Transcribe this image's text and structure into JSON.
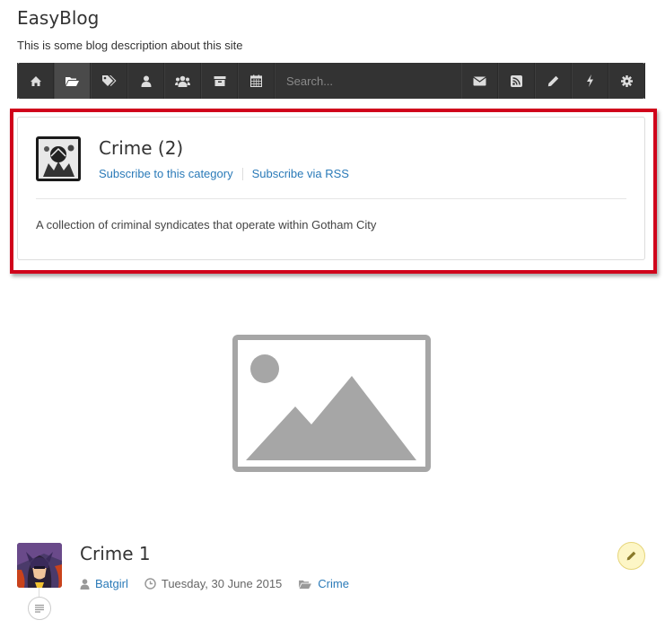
{
  "site": {
    "title": "EasyBlog",
    "description": "This is some blog description about this site"
  },
  "toolbar": {
    "buttons_left": [
      "home-icon",
      "folder-open-icon",
      "tags-icon",
      "user-icon",
      "users-icon",
      "archive-icon",
      "calendar-icon"
    ],
    "active": "folder-open-icon",
    "search_placeholder": "Search...",
    "buttons_right": [
      "envelope-icon",
      "rss-icon",
      "pencil-icon",
      "bolt-icon",
      "gear-icon"
    ]
  },
  "category": {
    "title": "Crime (2)",
    "subscribe_label": "Subscribe to this category",
    "rss_label": "Subscribe via RSS",
    "description": "A collection of criminal syndicates that operate within Gotham City",
    "highlight_color": "#d0021b"
  },
  "post": {
    "title": "Crime 1",
    "author": "Batgirl",
    "date": "Tuesday, 30 June 2015",
    "category": "Crime"
  },
  "colors": {
    "toolbar_bg": "#333333",
    "link": "#2a7ab8"
  }
}
